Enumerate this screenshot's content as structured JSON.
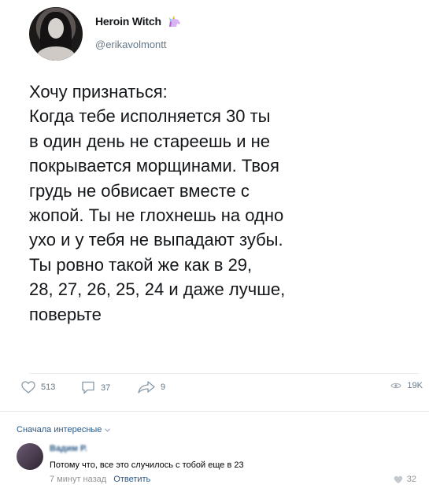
{
  "post": {
    "author_name": "Heroin Witch",
    "handle": "@erikavolmontt",
    "text": "Хочу признаться:\nКогда тебе исполняется 30 ты\nв один день не стареешь и не\nпокрывается морщинами. Твоя\nгрудь не обвисает вместе с\nжопой. Ты не глохнешь на одно\nухо и у тебя не выпадают зубы.\nТы ровно такой же как в 29,\n28, 27, 26, 25, 24 и даже лучше,\nповерьте"
  },
  "actions": {
    "likes": "513",
    "comments": "37",
    "shares": "9",
    "views": "19K"
  },
  "comments_section": {
    "sort_label": "Сначала интересные",
    "items": [
      {
        "author": "Вадим Р.",
        "text": "Потому что, все это случилось с тобой еще в 23",
        "time": "7 минут назад",
        "reply_label": "Ответить",
        "likes": "32"
      }
    ]
  },
  "colors": {
    "text": "#14171a",
    "muted": "#657786",
    "vk_link": "#2a5885",
    "unicorn": "#b464d6"
  }
}
